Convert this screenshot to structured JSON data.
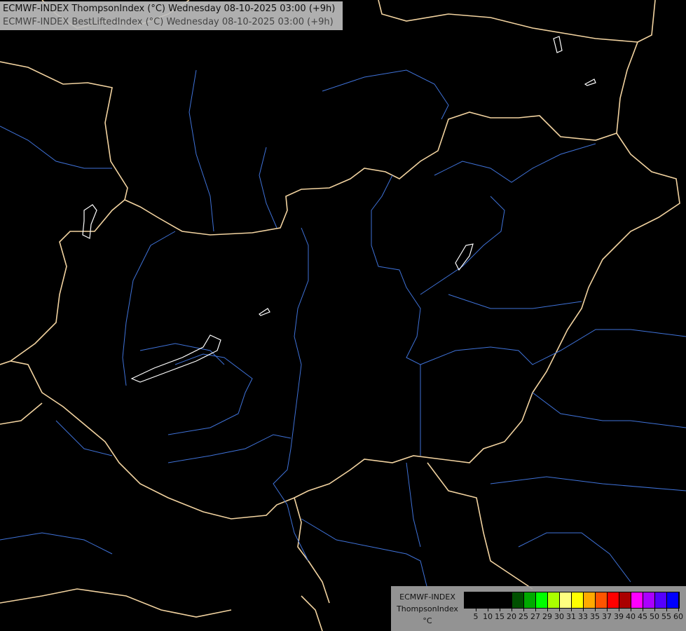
{
  "title": {
    "line1": "ECMWF-INDEX ThompsonIndex (°C) Wednesday 08-10-2025 03:00 (+9h)",
    "line2": "ECMWF-INDEX BestLiftedIndex (°C) Wednesday 08-10-2025 03:00 (+9h)"
  },
  "legend": {
    "model": "ECMWF-INDEX",
    "parameter": "ThompsonIndex",
    "unit": "°C",
    "colors": [
      "#000000",
      "#000000",
      "#000000",
      "#000000",
      "#005000",
      "#00aa00",
      "#00ff00",
      "#aaff00",
      "#ffff80",
      "#ffff00",
      "#ffaa00",
      "#ff5500",
      "#ff0000",
      "#aa0000",
      "#ff00ff",
      "#aa00ff",
      "#5500ff",
      "#0000ff"
    ],
    "labels": [
      "5",
      "10",
      "15",
      "20",
      "25",
      "27",
      "29",
      "30",
      "31",
      "33",
      "35",
      "37",
      "39",
      "40",
      "45",
      "50",
      "55",
      "60"
    ]
  },
  "map": {
    "border_color": "#f2d3a0",
    "river_color": "#3f72d8",
    "lake_color": "#ffffff"
  }
}
